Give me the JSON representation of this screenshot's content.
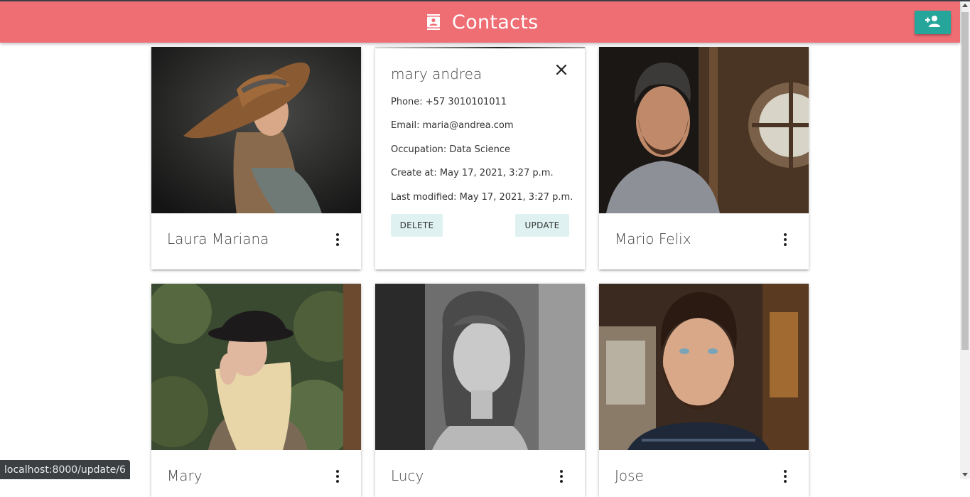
{
  "header": {
    "title": "Contacts",
    "icon": "contacts-icon",
    "add_button_icon": "person-add-icon",
    "color": "#ef6e74",
    "accent": "#26a69a"
  },
  "contacts": [
    {
      "name": "Laura Mariana"
    },
    {
      "name": "Mario Felix"
    },
    {
      "name": "Mary"
    },
    {
      "name": "Lucy"
    },
    {
      "name": "Jose"
    }
  ],
  "detail": {
    "name": "mary andrea",
    "phone": "Phone: +57 3010101011",
    "email": "Email: maria@andrea.com",
    "occupation": "Occupation: Data Science",
    "created": "Create at: May 17, 2021, 3:27 p.m.",
    "modified": "Last modified: May 17, 2021, 3:27 p.m.",
    "delete_label": "DELETE",
    "update_label": "UPDATE"
  },
  "status_bar": {
    "url": "localhost:8000/update/6"
  }
}
